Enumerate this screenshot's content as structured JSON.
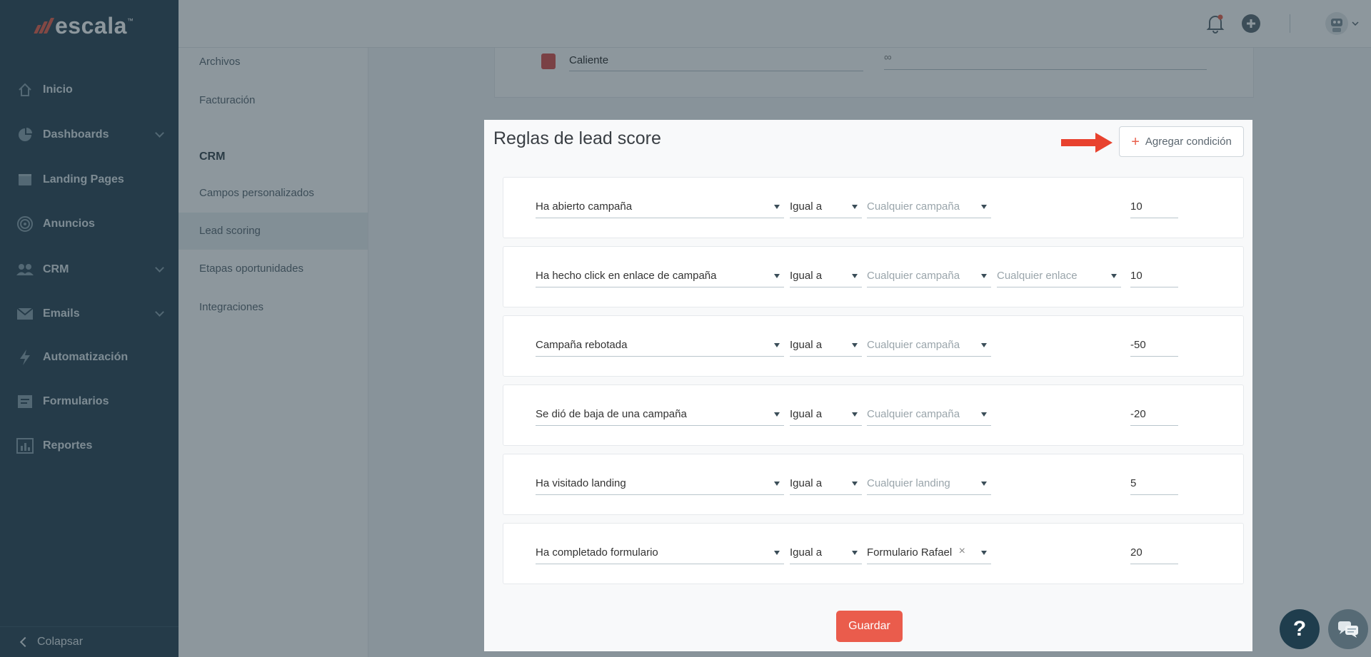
{
  "brand": {
    "name": "escala",
    "tm": "™"
  },
  "sidebar": {
    "items": [
      {
        "label": "Inicio",
        "icon": "home-icon",
        "has_submenu": false
      },
      {
        "label": "Dashboards",
        "icon": "pie-chart-icon",
        "has_submenu": true
      },
      {
        "label": "Landing Pages",
        "icon": "browser-icon",
        "has_submenu": false
      },
      {
        "label": "Anuncios",
        "icon": "target-icon",
        "has_submenu": false
      },
      {
        "label": "CRM",
        "icon": "users-icon",
        "has_submenu": true
      },
      {
        "label": "Emails",
        "icon": "envelope-icon",
        "has_submenu": true
      },
      {
        "label": "Automatización",
        "icon": "lightning-icon",
        "has_submenu": false
      },
      {
        "label": "Formularios",
        "icon": "form-icon",
        "has_submenu": false
      },
      {
        "label": "Reportes",
        "icon": "bar-chart-icon",
        "has_submenu": false
      }
    ],
    "collapse_label": "Colapsar"
  },
  "topbar": {
    "icons": [
      "bell-icon",
      "plus-circle-icon",
      "avatar",
      "chevron-down-icon"
    ],
    "notification_dot_color": "#e8604c"
  },
  "subnav": {
    "items_top": [
      "Archivos",
      "Facturación"
    ],
    "section_title": "CRM",
    "items_crm": [
      "Campos personalizados",
      "Lead scoring",
      "Etapas oportunidades",
      "Integraciones"
    ],
    "active": "Lead scoring"
  },
  "background": {
    "stage_label": "Caliente",
    "stage_value": "∞",
    "stage_color": "#d9534f"
  },
  "modal": {
    "title": "Reglas de lead score",
    "add_button": "Agregar condición",
    "save_button": "Guardar",
    "rules": [
      {
        "condition": "Ha abierto campaña",
        "operator": "Igual a",
        "target": "Cualquier campaña",
        "target_placeholder": true,
        "extra": null,
        "score": "10"
      },
      {
        "condition": "Ha hecho click en enlace de campaña",
        "operator": "Igual a",
        "target": "Cualquier campaña",
        "target_placeholder": true,
        "extra": "Cualquier enlace",
        "score": "10"
      },
      {
        "condition": "Campaña rebotada",
        "operator": "Igual a",
        "target": "Cualquier campaña",
        "target_placeholder": true,
        "extra": null,
        "score": "-50"
      },
      {
        "condition": "Se dió de baja de una campaña",
        "operator": "Igual a",
        "target": "Cualquier campaña",
        "target_placeholder": true,
        "extra": null,
        "score": "-20"
      },
      {
        "condition": "Ha visitado landing",
        "operator": "Igual a",
        "target": "Cualquier landing",
        "target_placeholder": true,
        "extra": null,
        "score": "5"
      },
      {
        "condition": "Ha completado formulario",
        "operator": "Igual a",
        "target": "Formulario Rafael",
        "target_placeholder": false,
        "extra": null,
        "score": "20"
      }
    ]
  },
  "help": {
    "label": "?"
  },
  "colors": {
    "accent": "#e8604c",
    "sidebar_bg": "#2e4756",
    "save": "#ea5c4c"
  }
}
